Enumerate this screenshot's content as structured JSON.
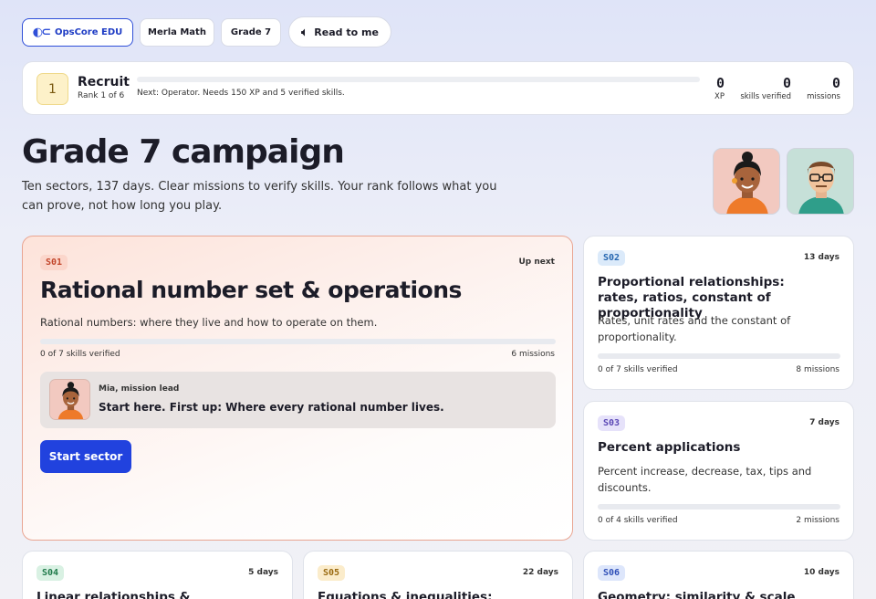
{
  "topbar": {
    "brand": "OpsCore EDU",
    "subject": "Merla Math",
    "grade": "Grade 7",
    "read_label": "Read to me"
  },
  "rank": {
    "badge": "1",
    "title": "Recruit",
    "subtitle": "Rank 1 of 6",
    "progress": 0,
    "next": "Next: Operator. Needs 150 XP and 5 verified skills.",
    "stats": [
      {
        "value": "0",
        "label": "XP"
      },
      {
        "value": "0",
        "label": "skills verified"
      },
      {
        "value": "0",
        "label": "missions"
      }
    ]
  },
  "header": {
    "title": "Grade 7 campaign",
    "lede": "Ten sectors, 137 days. Clear missions to verify skills. Your rank follows what you can prove, not how long you play."
  },
  "featured": {
    "tag": "S01",
    "status": "Up next",
    "title": "Rational number set & operations",
    "description": "Rational numbers: where they live and how to operate on them.",
    "progress_text": "0 of 7 skills verified",
    "missions": "6 missions",
    "lead_name": "Mia, mission lead",
    "lead_message": "Start here. First up: Where every rational number lives.",
    "cta": "Start sector"
  },
  "sectors": [
    {
      "tag": "S02",
      "days": "13 days",
      "title": "Proportional relationships: rates, ratios, constant of proportionality",
      "description": "Rates, unit rates and the constant of proportionality.",
      "progress_text": "0 of 7 skills verified",
      "missions": "8 missions"
    },
    {
      "tag": "S03",
      "days": "7 days",
      "title": "Percent applications",
      "description": "Percent increase, decrease, tax, tips and discounts.",
      "progress_text": "0 of 4 skills verified",
      "missions": "2 missions"
    },
    {
      "tag": "S04",
      "days": "5 days",
      "title": "Linear relationships & representations"
    },
    {
      "tag": "S05",
      "days": "22 days",
      "title": "Equations & inequalities:"
    },
    {
      "tag": "S06",
      "days": "10 days",
      "title": "Geometry: similarity & scale drawings"
    }
  ]
}
